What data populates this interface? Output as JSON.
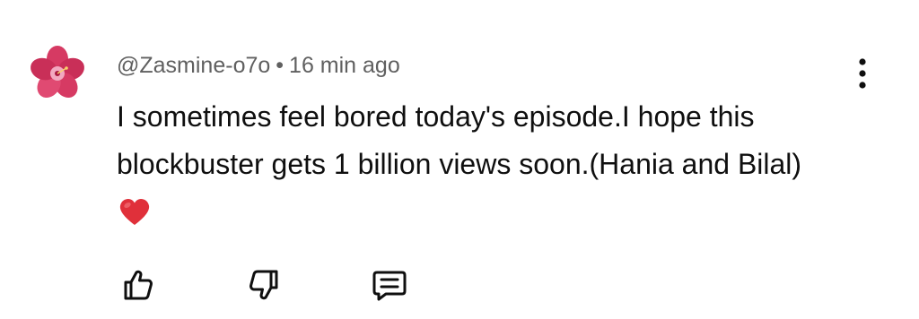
{
  "comment": {
    "author": "@Zasmine-o7o",
    "separator": "•",
    "time": "16 min ago",
    "text": "I sometimes feel bored today's episode.I hope this blockbuster gets 1 billion views soon.(Hania and Bilal)",
    "trailing_icon": "red-heart-emoji"
  },
  "avatar": {
    "icon": "hibiscus-flower",
    "petal_color": "#d63a63",
    "center_color": "#f2a9c0"
  },
  "menu": {
    "icon": "more-vertical-icon"
  },
  "actions": {
    "like_icon": "thumbs-up-icon",
    "dislike_icon": "thumbs-down-icon",
    "reply_icon": "reply-comment-icon"
  },
  "colors": {
    "meta_text": "#606060",
    "body_text": "#0f0f0f",
    "heart": "#e0303a"
  }
}
